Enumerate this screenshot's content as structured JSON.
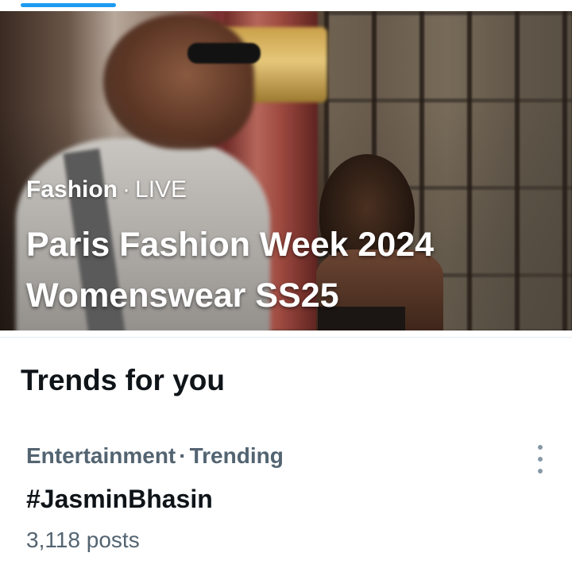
{
  "colors": {
    "accent": "#1d9bf0",
    "text_primary": "#0f1419",
    "text_secondary": "#536471"
  },
  "hero": {
    "category": "Fashion",
    "separator": "·",
    "status": "LIVE",
    "title_line1": "Paris Fashion Week 2024",
    "title_line2": "Womenswear SS25"
  },
  "section": {
    "title": "Trends for you"
  },
  "trends": [
    {
      "category": "Entertainment",
      "separator": "·",
      "status": "Trending",
      "name": "#JasminBhasin",
      "count": "3,118 posts",
      "more_icon": "more-vertical-icon"
    }
  ]
}
